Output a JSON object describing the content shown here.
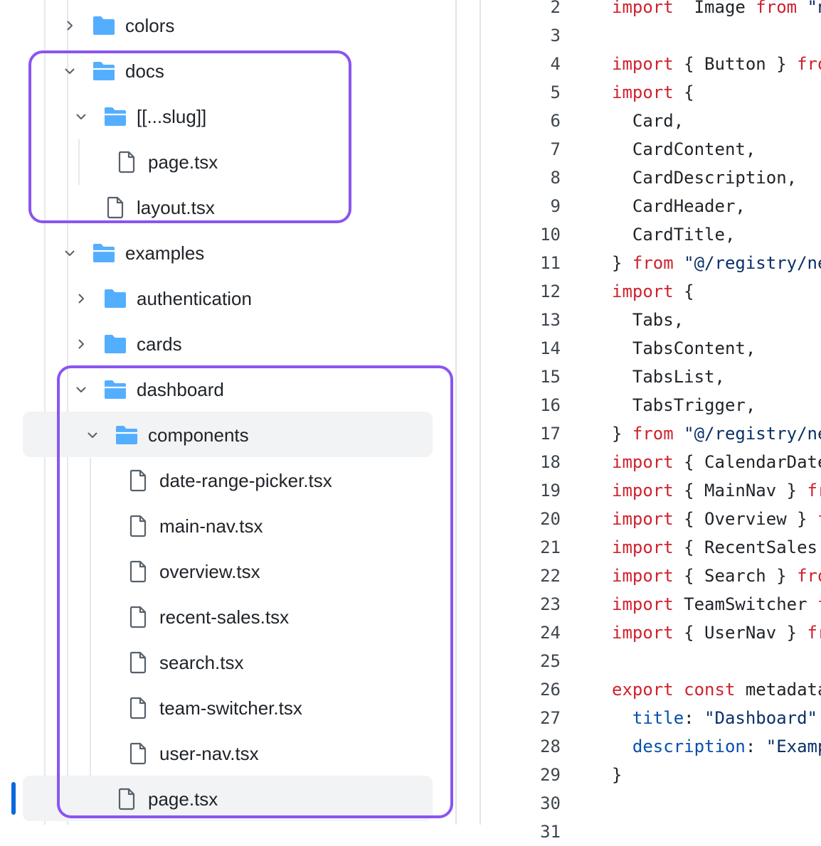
{
  "tree": {
    "rows": [
      {
        "label": "colors",
        "type": "folder",
        "depth": 0,
        "chevron": "right"
      },
      {
        "label": "docs",
        "type": "folder-open",
        "depth": 0,
        "chevron": "down"
      },
      {
        "label": "[[...slug]]",
        "type": "folder-open",
        "depth": 1,
        "chevron": "down"
      },
      {
        "label": "page.tsx",
        "type": "file",
        "depth": 2,
        "chevron": "none"
      },
      {
        "label": "layout.tsx",
        "type": "file",
        "depth": 1,
        "chevron": "none"
      },
      {
        "label": "examples",
        "type": "folder-open",
        "depth": 0,
        "chevron": "down"
      },
      {
        "label": "authentication",
        "type": "folder",
        "depth": 1,
        "chevron": "right"
      },
      {
        "label": "cards",
        "type": "folder",
        "depth": 1,
        "chevron": "right"
      },
      {
        "label": "dashboard",
        "type": "folder-open",
        "depth": 1,
        "chevron": "down"
      },
      {
        "label": "components",
        "type": "folder-open",
        "depth": 2,
        "chevron": "down"
      },
      {
        "label": "date-range-picker.tsx",
        "type": "file",
        "depth": 3,
        "chevron": "none"
      },
      {
        "label": "main-nav.tsx",
        "type": "file",
        "depth": 3,
        "chevron": "none"
      },
      {
        "label": "overview.tsx",
        "type": "file",
        "depth": 3,
        "chevron": "none"
      },
      {
        "label": "recent-sales.tsx",
        "type": "file",
        "depth": 3,
        "chevron": "none"
      },
      {
        "label": "search.tsx",
        "type": "file",
        "depth": 3,
        "chevron": "none"
      },
      {
        "label": "team-switcher.tsx",
        "type": "file",
        "depth": 3,
        "chevron": "none"
      },
      {
        "label": "user-nav.tsx",
        "type": "file",
        "depth": 3,
        "chevron": "none"
      },
      {
        "label": "page.tsx",
        "type": "file",
        "depth": 2,
        "chevron": "none"
      }
    ]
  },
  "code": {
    "lines": [
      {
        "num": "2",
        "tokens": [
          [
            "kw",
            "import"
          ],
          [
            "",
            "  Image "
          ],
          [
            "kw",
            "from"
          ],
          [
            "str",
            " \"ne"
          ]
        ]
      },
      {
        "num": "3",
        "tokens": []
      },
      {
        "num": "4",
        "tokens": [
          [
            "kw",
            "import"
          ],
          [
            "",
            " { Button } "
          ],
          [
            "kw",
            "fro"
          ]
        ]
      },
      {
        "num": "5",
        "tokens": [
          [
            "kw",
            "import"
          ],
          [
            "",
            " {"
          ]
        ]
      },
      {
        "num": "6",
        "tokens": [
          [
            "",
            "  Card,"
          ]
        ]
      },
      {
        "num": "7",
        "tokens": [
          [
            "",
            "  CardContent,"
          ]
        ]
      },
      {
        "num": "8",
        "tokens": [
          [
            "",
            "  CardDescription,"
          ]
        ]
      },
      {
        "num": "9",
        "tokens": [
          [
            "",
            "  CardHeader,"
          ]
        ]
      },
      {
        "num": "10",
        "tokens": [
          [
            "",
            "  CardTitle,"
          ]
        ]
      },
      {
        "num": "11",
        "tokens": [
          [
            "",
            "} "
          ],
          [
            "kw",
            "from"
          ],
          [
            "str",
            " \"@/registry/ne"
          ]
        ]
      },
      {
        "num": "12",
        "tokens": [
          [
            "kw",
            "import"
          ],
          [
            "",
            " {"
          ]
        ]
      },
      {
        "num": "13",
        "tokens": [
          [
            "",
            "  Tabs,"
          ]
        ]
      },
      {
        "num": "14",
        "tokens": [
          [
            "",
            "  TabsContent,"
          ]
        ]
      },
      {
        "num": "15",
        "tokens": [
          [
            "",
            "  TabsList,"
          ]
        ]
      },
      {
        "num": "16",
        "tokens": [
          [
            "",
            "  TabsTrigger,"
          ]
        ]
      },
      {
        "num": "17",
        "tokens": [
          [
            "",
            "} "
          ],
          [
            "kw",
            "from"
          ],
          [
            "str",
            " \"@/registry/ne"
          ]
        ]
      },
      {
        "num": "18",
        "tokens": [
          [
            "kw",
            "import"
          ],
          [
            "",
            " { CalendarDate"
          ]
        ]
      },
      {
        "num": "19",
        "tokens": [
          [
            "kw",
            "import"
          ],
          [
            "",
            " { MainNav } "
          ],
          [
            "kw",
            "fr"
          ]
        ]
      },
      {
        "num": "20",
        "tokens": [
          [
            "kw",
            "import"
          ],
          [
            "",
            " { Overview } "
          ],
          [
            "kw",
            "f"
          ]
        ]
      },
      {
        "num": "21",
        "tokens": [
          [
            "kw",
            "import"
          ],
          [
            "",
            " { RecentSales "
          ]
        ]
      },
      {
        "num": "22",
        "tokens": [
          [
            "kw",
            "import"
          ],
          [
            "",
            " { Search } "
          ],
          [
            "kw",
            "fro"
          ]
        ]
      },
      {
        "num": "23",
        "tokens": [
          [
            "kw",
            "import"
          ],
          [
            "",
            " TeamSwitcher "
          ],
          [
            "kw",
            "f"
          ]
        ]
      },
      {
        "num": "24",
        "tokens": [
          [
            "kw",
            "import"
          ],
          [
            "",
            " { UserNav } "
          ],
          [
            "kw",
            "fr"
          ]
        ]
      },
      {
        "num": "25",
        "tokens": []
      },
      {
        "num": "26",
        "tokens": [
          [
            "kw",
            "export"
          ],
          [
            "",
            " "
          ],
          [
            "kw",
            "const"
          ],
          [
            "",
            " metadata"
          ]
        ]
      },
      {
        "num": "27",
        "tokens": [
          [
            "prop",
            "  title"
          ],
          [
            "",
            ": "
          ],
          [
            "str",
            "\"Dashboard\""
          ],
          [
            "",
            ","
          ]
        ]
      },
      {
        "num": "28",
        "tokens": [
          [
            "prop",
            "  description"
          ],
          [
            "",
            ": "
          ],
          [
            "str",
            "\"Examp"
          ]
        ]
      },
      {
        "num": "29",
        "tokens": [
          [
            "",
            "}"
          ]
        ]
      },
      {
        "num": "30",
        "tokens": []
      },
      {
        "num": "31",
        "tokens": []
      }
    ]
  },
  "colors": {
    "folder": "#54aeff",
    "annotation": "#8a55f0",
    "keyword": "#cf222e",
    "string": "#0a3069",
    "property": "#0550ae",
    "active_indicator": "#0969da"
  },
  "icons": [
    "chevron-right-icon",
    "chevron-down-icon",
    "folder-icon",
    "folder-open-icon",
    "file-icon"
  ]
}
